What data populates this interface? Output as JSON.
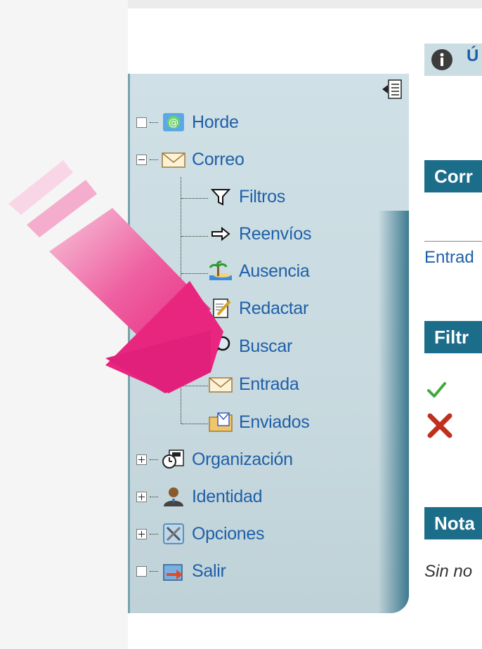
{
  "sidebar": {
    "items": [
      {
        "key": "horde",
        "label": "Horde",
        "icon": "horde-icon",
        "expander": "none"
      },
      {
        "key": "correo",
        "label": "Correo",
        "icon": "mail-icon",
        "expander": "minus"
      },
      {
        "key": "filtros",
        "label": "Filtros",
        "icon": "filter-icon"
      },
      {
        "key": "reenvios",
        "label": "Reenvíos",
        "icon": "forward-arrow-icon"
      },
      {
        "key": "ausencia",
        "label": "Ausencia",
        "icon": "vacation-icon"
      },
      {
        "key": "redactar",
        "label": "Redactar",
        "icon": "compose-icon"
      },
      {
        "key": "buscar",
        "label": "Buscar",
        "icon": "search-icon"
      },
      {
        "key": "entrada",
        "label": "Entrada",
        "icon": "inbox-icon"
      },
      {
        "key": "enviados",
        "label": "Enviados",
        "icon": "sent-folder-icon"
      },
      {
        "key": "organizacion",
        "label": "Organización",
        "icon": "organizer-icon",
        "expander": "plus"
      },
      {
        "key": "identidad",
        "label": "Identidad",
        "icon": "identity-icon",
        "expander": "plus"
      },
      {
        "key": "opciones",
        "label": "Opciones",
        "icon": "options-icon",
        "expander": "plus"
      },
      {
        "key": "salir",
        "label": "Salir",
        "icon": "logout-icon",
        "expander": "none"
      }
    ]
  },
  "main": {
    "info_text": "Ú",
    "sections": [
      {
        "key": "correo",
        "title": "Corr"
      },
      {
        "key": "filtros",
        "title": "Filtr"
      },
      {
        "key": "notas",
        "title": "Nota"
      }
    ],
    "inbox_label": "Entrad",
    "notes_empty": "Sin no"
  },
  "colors": {
    "link": "#1f5fa8",
    "header_bg": "#1c6d8a",
    "sidebar_bg": "#cfe0e6",
    "arrow": "#e8267f"
  }
}
